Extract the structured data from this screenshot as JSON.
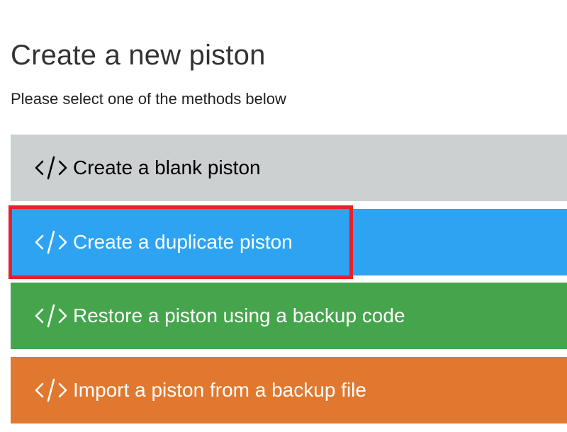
{
  "page": {
    "title": "Create a new piston",
    "subtitle": "Please select one of the methods below"
  },
  "options": [
    {
      "label": "Create a blank piston",
      "icon": "code-icon",
      "color": "#ccd0d1",
      "text_color": "#000000"
    },
    {
      "label": "Create a duplicate piston",
      "icon": "code-icon",
      "color": "#2ea3f2",
      "text_color": "#ffffff",
      "highlighted": true
    },
    {
      "label": "Restore a piston using a backup code",
      "icon": "code-icon",
      "color": "#45a54c",
      "text_color": "#ffffff"
    },
    {
      "label": "Import a piston from a backup file",
      "icon": "code-icon",
      "color": "#e1782f",
      "text_color": "#ffffff"
    }
  ],
  "highlight_color": "#e8202a"
}
